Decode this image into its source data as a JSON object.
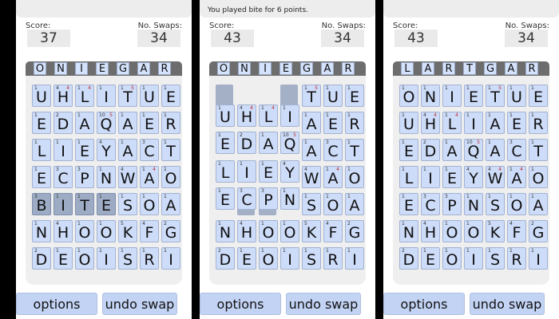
{
  "labels": {
    "score": "Score:",
    "swaps": "No. Swaps:",
    "options": "options",
    "undo": "undo swap"
  },
  "colors": {
    "tile": "#cddcf8",
    "tile_highlight": "#9dacc4",
    "rack": "#6d6d6d",
    "button": "#c3d3f4",
    "board": "#efefef"
  },
  "panels": [
    {
      "message": "",
      "score": "37",
      "swaps": "34",
      "rack": [
        "O",
        "N",
        "I",
        "E",
        "G",
        "A",
        "R"
      ],
      "rows": [
        [
          {
            "ch": "U",
            "pt": "1"
          },
          {
            "ch": "H",
            "pt": "4",
            "mk": "4"
          },
          {
            "ch": "L",
            "pt": "1",
            "mk": "4"
          },
          {
            "ch": "I",
            "pt": "1"
          },
          {
            "ch": "T",
            "pt": "1",
            "mk": "5"
          },
          {
            "ch": "U",
            "pt": "1"
          },
          {
            "ch": "E",
            "pt": "1"
          }
        ],
        [
          {
            "ch": "E",
            "pt": "1"
          },
          {
            "ch": "D",
            "pt": "2"
          },
          {
            "ch": "A",
            "pt": "1"
          },
          {
            "ch": "Q",
            "pt": "10",
            "mk": "5"
          },
          {
            "ch": "A",
            "pt": "1"
          },
          {
            "ch": "E",
            "pt": "1"
          },
          {
            "ch": "R",
            "pt": "1"
          }
        ],
        [
          {
            "ch": "L",
            "pt": "1"
          },
          {
            "ch": "I",
            "pt": "1"
          },
          {
            "ch": "E",
            "pt": "1"
          },
          {
            "ch": "Y",
            "pt": "4"
          },
          {
            "ch": "A",
            "pt": "1"
          },
          {
            "ch": "C",
            "pt": "3"
          },
          {
            "ch": "T",
            "pt": "1"
          }
        ],
        [
          {
            "ch": "E",
            "pt": "1"
          },
          {
            "ch": "C",
            "pt": "3"
          },
          {
            "ch": "P",
            "pt": "3"
          },
          {
            "ch": "N",
            "pt": "1"
          },
          {
            "ch": "W",
            "pt": "4"
          },
          {
            "ch": "A",
            "pt": "1",
            "mk": "4"
          },
          {
            "ch": "O",
            "pt": "1"
          }
        ],
        [
          {
            "ch": "B",
            "pt": "3",
            "hl": true
          },
          {
            "ch": "I",
            "pt": "1",
            "hl": true
          },
          {
            "ch": "T",
            "pt": "1",
            "hl": true
          },
          {
            "ch": "E",
            "pt": "1",
            "hl": true
          },
          {
            "ch": "S",
            "pt": "1"
          },
          {
            "ch": "O",
            "pt": "1"
          },
          {
            "ch": "A",
            "pt": "1"
          }
        ],
        [
          {
            "ch": "N",
            "pt": "1"
          },
          {
            "ch": "H",
            "pt": "4"
          },
          {
            "ch": "O",
            "pt": "1"
          },
          {
            "ch": "O",
            "pt": "1"
          },
          {
            "ch": "K",
            "pt": "5"
          },
          {
            "ch": "F",
            "pt": "4"
          },
          {
            "ch": "G",
            "pt": "2"
          }
        ],
        [
          {
            "ch": "D",
            "pt": "2"
          },
          {
            "ch": "E",
            "pt": "1"
          },
          {
            "ch": "O",
            "pt": "1"
          },
          {
            "ch": "I",
            "pt": "1"
          },
          {
            "ch": "S",
            "pt": "1"
          },
          {
            "ch": "R",
            "pt": "1"
          },
          {
            "ch": "I",
            "pt": "1"
          }
        ]
      ]
    },
    {
      "message": "You played bite for 6 points.",
      "score": "43",
      "swaps": "34",
      "rack": [
        "O",
        "N",
        "I",
        "E",
        "G",
        "A",
        "R"
      ],
      "rows": [
        [
          {
            "ch": ""
          },
          {
            "ch": ""
          },
          {
            "ch": ""
          },
          {
            "ch": ""
          },
          {
            "ch": "T",
            "pt": "1",
            "mk": "5"
          },
          {
            "ch": "U",
            "pt": "1"
          },
          {
            "ch": "E",
            "pt": "1"
          }
        ],
        [
          {
            "ch": "U",
            "pt": "1"
          },
          {
            "ch": "H",
            "pt": "4",
            "mk": "4"
          },
          {
            "ch": "L",
            "pt": "1",
            "mk": "4"
          },
          {
            "ch": "I",
            "pt": "1"
          },
          {
            "ch": "A",
            "pt": "1"
          },
          {
            "ch": "E",
            "pt": "1"
          },
          {
            "ch": "R",
            "pt": "1"
          }
        ],
        [
          {
            "ch": "E",
            "pt": "1"
          },
          {
            "ch": "D",
            "pt": "2"
          },
          {
            "ch": "A",
            "pt": "1"
          },
          {
            "ch": "Q",
            "pt": "10",
            "mk": "5"
          },
          {
            "ch": "A",
            "pt": "1"
          },
          {
            "ch": "C",
            "pt": "3"
          },
          {
            "ch": "T",
            "pt": "1"
          }
        ],
        [
          {
            "ch": "L",
            "pt": "1"
          },
          {
            "ch": "I",
            "pt": "1"
          },
          {
            "ch": "E",
            "pt": "1"
          },
          {
            "ch": "Y",
            "pt": "4"
          },
          {
            "ch": "W",
            "pt": "4"
          },
          {
            "ch": "A",
            "pt": "1",
            "mk": "4"
          },
          {
            "ch": "O",
            "pt": "1"
          }
        ],
        [
          {
            "ch": "E",
            "pt": "1"
          },
          {
            "ch": "C",
            "pt": "3"
          },
          {
            "ch": "P",
            "pt": "3"
          },
          {
            "ch": "N",
            "pt": "1"
          },
          {
            "ch": "S",
            "pt": "1"
          },
          {
            "ch": "O",
            "pt": "1"
          },
          {
            "ch": "A",
            "pt": "1"
          }
        ],
        [
          {
            "ch": "N",
            "pt": "1"
          },
          {
            "ch": "H",
            "pt": "4"
          },
          {
            "ch": "O",
            "pt": "1"
          },
          {
            "ch": "O",
            "pt": "1"
          },
          {
            "ch": "K",
            "pt": "5"
          },
          {
            "ch": "F",
            "pt": "4"
          },
          {
            "ch": "G",
            "pt": "2"
          }
        ],
        [
          {
            "ch": "D",
            "pt": "2"
          },
          {
            "ch": "E",
            "pt": "1"
          },
          {
            "ch": "O",
            "pt": "1"
          },
          {
            "ch": "I",
            "pt": "1"
          },
          {
            "ch": "S",
            "pt": "1"
          },
          {
            "ch": "R",
            "pt": "1"
          },
          {
            "ch": "I",
            "pt": "1"
          }
        ]
      ]
    },
    {
      "message": "",
      "score": "43",
      "swaps": "34",
      "rack": [
        "L",
        "A",
        "R",
        "T",
        "G",
        "A",
        "R"
      ],
      "rows": [
        [
          {
            "ch": "O",
            "pt": "1"
          },
          {
            "ch": "N",
            "pt": "1"
          },
          {
            "ch": "I",
            "pt": "1"
          },
          {
            "ch": "E",
            "pt": "1"
          },
          {
            "ch": "T",
            "pt": "1",
            "mk": "5"
          },
          {
            "ch": "U",
            "pt": "1"
          },
          {
            "ch": "E",
            "pt": "1"
          }
        ],
        [
          {
            "ch": "U",
            "pt": "1"
          },
          {
            "ch": "H",
            "pt": "4",
            "mk": "4"
          },
          {
            "ch": "L",
            "pt": "1",
            "mk": "4"
          },
          {
            "ch": "I",
            "pt": "1"
          },
          {
            "ch": "A",
            "pt": "1"
          },
          {
            "ch": "E",
            "pt": "1"
          },
          {
            "ch": "R",
            "pt": "1"
          }
        ],
        [
          {
            "ch": "E",
            "pt": "1"
          },
          {
            "ch": "D",
            "pt": "2"
          },
          {
            "ch": "A",
            "pt": "1"
          },
          {
            "ch": "Q",
            "pt": "10",
            "mk": "5"
          },
          {
            "ch": "A",
            "pt": "1"
          },
          {
            "ch": "C",
            "pt": "3"
          },
          {
            "ch": "T",
            "pt": "1"
          }
        ],
        [
          {
            "ch": "L",
            "pt": "1"
          },
          {
            "ch": "I",
            "pt": "1"
          },
          {
            "ch": "E",
            "pt": "1"
          },
          {
            "ch": "Y",
            "pt": "4"
          },
          {
            "ch": "W",
            "pt": "4",
            "mk": "4"
          },
          {
            "ch": "A",
            "pt": "1",
            "mk": "4"
          },
          {
            "ch": "O",
            "pt": "1"
          }
        ],
        [
          {
            "ch": "E",
            "pt": "1"
          },
          {
            "ch": "C",
            "pt": "3"
          },
          {
            "ch": "P",
            "pt": "3"
          },
          {
            "ch": "N",
            "pt": "1"
          },
          {
            "ch": "S",
            "pt": "1"
          },
          {
            "ch": "O",
            "pt": "1"
          },
          {
            "ch": "A",
            "pt": "1"
          }
        ],
        [
          {
            "ch": "N",
            "pt": "1"
          },
          {
            "ch": "H",
            "pt": "4"
          },
          {
            "ch": "O",
            "pt": "1"
          },
          {
            "ch": "O",
            "pt": "1"
          },
          {
            "ch": "K",
            "pt": "5"
          },
          {
            "ch": "F",
            "pt": "4"
          },
          {
            "ch": "G",
            "pt": "2"
          }
        ],
        [
          {
            "ch": "D",
            "pt": "2"
          },
          {
            "ch": "E",
            "pt": "1"
          },
          {
            "ch": "O",
            "pt": "1"
          },
          {
            "ch": "I",
            "pt": "1"
          },
          {
            "ch": "S",
            "pt": "1"
          },
          {
            "ch": "R",
            "pt": "1"
          },
          {
            "ch": "I",
            "pt": "1"
          }
        ]
      ]
    }
  ]
}
